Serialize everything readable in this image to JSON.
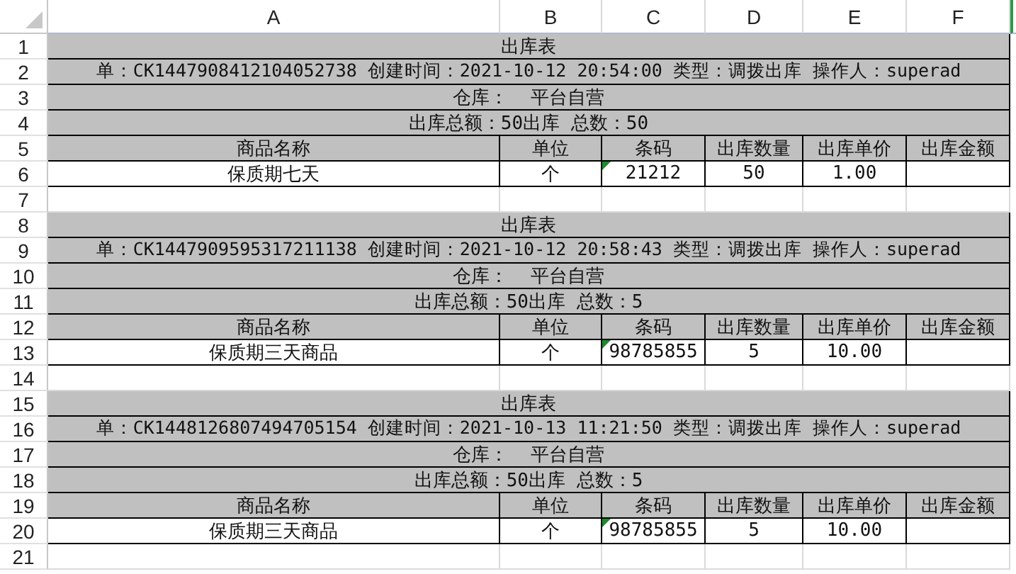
{
  "columns": [
    "A",
    "B",
    "C",
    "D",
    "E",
    "F"
  ],
  "rows": [
    {
      "number": "1",
      "kind": "merged",
      "text": "出库表"
    },
    {
      "number": "2",
      "kind": "info",
      "text": "单：CK1447908412104052738 创建时间：2021-10-12 20:54:00 类型：调拨出库 操作人：superad"
    },
    {
      "number": "3",
      "kind": "merged",
      "text": "仓库：  平台自营"
    },
    {
      "number": "4",
      "kind": "merged",
      "text": "出库总额：50出库 总数：50"
    },
    {
      "number": "5",
      "kind": "cells",
      "shaded": true,
      "cells": [
        {
          "text": "商品名称"
        },
        {
          "text": "单位"
        },
        {
          "text": "条码"
        },
        {
          "text": "出库数量"
        },
        {
          "text": "出库单价"
        },
        {
          "text": "出库金额"
        }
      ]
    },
    {
      "number": "6",
      "kind": "cells",
      "shaded": false,
      "cells": [
        {
          "text": "保质期七天"
        },
        {
          "text": "个"
        },
        {
          "text": "21212",
          "flag": true
        },
        {
          "text": "50"
        },
        {
          "text": "1.00"
        }
      ]
    },
    {
      "number": "7",
      "kind": "blank"
    },
    {
      "number": "8",
      "kind": "merged",
      "text": "出库表"
    },
    {
      "number": "9",
      "kind": "info",
      "text": "单：CK1447909595317211138 创建时间：2021-10-12 20:58:43 类型：调拨出库 操作人：superad"
    },
    {
      "number": "10",
      "kind": "merged",
      "text": "仓库：  平台自营"
    },
    {
      "number": "11",
      "kind": "merged",
      "text": "出库总额：50出库 总数：5"
    },
    {
      "number": "12",
      "kind": "cells",
      "shaded": true,
      "cells": [
        {
          "text": "商品名称"
        },
        {
          "text": "单位"
        },
        {
          "text": "条码"
        },
        {
          "text": "出库数量"
        },
        {
          "text": "出库单价"
        },
        {
          "text": "出库金额"
        }
      ]
    },
    {
      "number": "13",
      "kind": "cells",
      "shaded": false,
      "cells": [
        {
          "text": "保质期三天商品"
        },
        {
          "text": "个"
        },
        {
          "text": "98785855",
          "flag": true
        },
        {
          "text": "5"
        },
        {
          "text": "10.00"
        }
      ]
    },
    {
      "number": "14",
      "kind": "blank"
    },
    {
      "number": "15",
      "kind": "merged",
      "text": "出库表"
    },
    {
      "number": "16",
      "kind": "info",
      "text": "单：CK1448126807494705154 创建时间：2021-10-13 11:21:50 类型：调拨出库 操作人：superad"
    },
    {
      "number": "17",
      "kind": "merged",
      "text": "仓库：  平台自营"
    },
    {
      "number": "18",
      "kind": "merged",
      "text": "出库总额：50出库 总数：5"
    },
    {
      "number": "19",
      "kind": "cells",
      "shaded": true,
      "cells": [
        {
          "text": "商品名称"
        },
        {
          "text": "单位"
        },
        {
          "text": "条码"
        },
        {
          "text": "出库数量"
        },
        {
          "text": "出库单价"
        },
        {
          "text": "出库金额"
        }
      ]
    },
    {
      "number": "20",
      "kind": "cells",
      "shaded": false,
      "cells": [
        {
          "text": "保质期三天商品"
        },
        {
          "text": "个"
        },
        {
          "text": "98785855",
          "flag": true
        },
        {
          "text": "5"
        },
        {
          "text": "10.00"
        }
      ]
    },
    {
      "number": "21",
      "kind": "blank"
    }
  ]
}
